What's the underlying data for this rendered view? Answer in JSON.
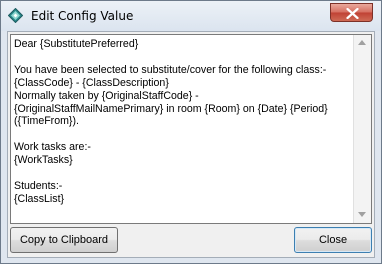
{
  "window": {
    "title": "Edit Config Value",
    "app_icon": "diamond-app-icon",
    "close_icon": "close-x-icon"
  },
  "editor": {
    "lines": [
      "Dear {SubstitutePreferred}",
      "",
      "You have been selected to substitute/cover for the following class:-",
      "{ClassCode} - {ClassDescription}",
      "Normally taken by {OriginalStaffCode} -",
      "{OriginalStaffMailNamePrimary} in room {Room} on {Date} {Period}",
      "({TimeFrom}).",
      "",
      "Work tasks are:-",
      "{WorkTasks}",
      "",
      "Students:-",
      "{ClassList}"
    ]
  },
  "buttons": {
    "copy_label": "Copy to Clipboard",
    "close_label": "Close"
  },
  "colors": {
    "title_bar": "#dbe4ef",
    "close_button": "#c04234",
    "app_icon": "#2a8a8c"
  }
}
